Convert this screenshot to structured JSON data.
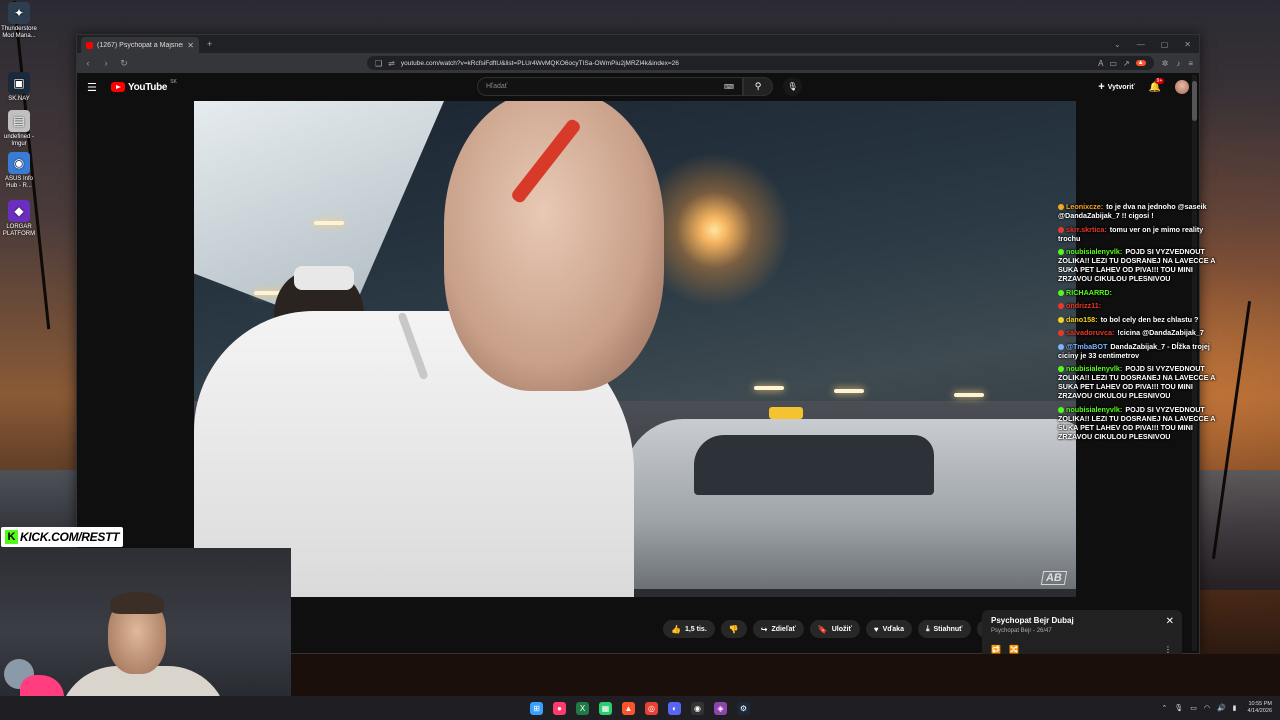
{
  "desktop": {
    "icons": [
      {
        "label": "Thunderstore Mod Mana...",
        "glyph": "✦",
        "color": "#2c3e50"
      },
      {
        "label": "SK.NAY",
        "glyph": "▣",
        "color": "#1b2a3a"
      },
      {
        "label": "undefined - Imgur",
        "glyph": "▤",
        "color": "#c0c0c0"
      },
      {
        "label": "ASUS Info Hub - R...",
        "glyph": "◉",
        "color": "#3a7bd5"
      },
      {
        "label": "LORGAR PLATFORM",
        "glyph": "◆",
        "color": "#6b2fbf"
      }
    ]
  },
  "browser": {
    "tab_title": "(1267) Psychopat a Majsner u",
    "url": "youtube.com/watch?v=kRcfsiFdftU&list=PLUr4WvMQKO6ocyTISa-OWmPiu2jMRZl4k&index=26"
  },
  "youtube": {
    "logo_text": "YouTube",
    "country_code": "SK",
    "search_placeholder": "Hľadať",
    "create_label": "Vytvoriť",
    "notif_count": "9+",
    "actions": {
      "likes": "1,5 tis.",
      "share": "Zdieľať",
      "save": "Uložiť",
      "thanks": "Vďaka",
      "download": "Stiahnuť"
    },
    "playlist": {
      "title": "Psychopat Bejr  Dubaj",
      "channel": "Psychopat Bejr",
      "position": "26/47"
    }
  },
  "chat": [
    {
      "user": "Leonixcze:",
      "text": "to je dva na jednoho @saseik @DandaZabijak_7 !! cigosi !",
      "color": "#f5a623"
    },
    {
      "user": "skrr.skrtica:",
      "text": "tomu ver on je mimo reality trochu",
      "color": "#e8392b"
    },
    {
      "user": "noubisialenyvlk:",
      "text": "POJD SI VYZVEDNOUT ZOLIKA!! LEZI TU DOSRANEJ NA LAVECCE A SUKA PET LAHEV OD PIVA!!! TOU MINI ZRZAVOU CIKULOU PLESNIVOU",
      "color": "#53fc18"
    },
    {
      "user": "RICHAARRD:",
      "text": "",
      "color": "#53fc18"
    },
    {
      "user": "ondrizz11:",
      "text": "",
      "color": "#e8392b"
    },
    {
      "user": "dano158:",
      "text": "to bol cely den bez chlastu ?",
      "color": "#f5d323"
    },
    {
      "user": "salvadoruvca:",
      "text": "!cicina @DandaZabijak_7",
      "color": "#e8392b"
    },
    {
      "user": "@TmbaBOT",
      "text": "DandaZabijak_7 - Dĺžka trojej ciciny je 33 centimetrov",
      "color": "#7ab4ff"
    },
    {
      "user": "noubisialenyvlk:",
      "text": "POJD SI VYZVEDNOUT ZOLIKA!! LEZI TU DOSRANEJ NA LAVECCE A SUKA PET LAHEV OD PIVA!!! TOU MINI ZRZAVOU CIKULOU PLESNIVOU",
      "color": "#53fc18"
    },
    {
      "user": "noubisialenyvlk:",
      "text": "POJD SI VYZVEDNOUT ZOLIKA!! LEZI TU DOSRANEJ NA LAVECCE A SUKA PET LAHEV OD PIVA!!! TOU MINI ZRZAVOU CIKULOU PLESNIVOU",
      "color": "#53fc18"
    }
  ],
  "overlay": {
    "kick_text": "KICK.COM/RESTT",
    "kick_logo": "K"
  },
  "taskbar": {
    "apps": [
      {
        "name": "windows-start-icon",
        "glyph": "⊞",
        "color": "#3aa0ff"
      },
      {
        "name": "maps-pin-icon",
        "glyph": "●",
        "color": "#ff3b6b"
      },
      {
        "name": "excel-icon",
        "glyph": "X",
        "color": "#1f7a45"
      },
      {
        "name": "spreadsheet-icon",
        "glyph": "▦",
        "color": "#2ecc71"
      },
      {
        "name": "brave-icon",
        "glyph": "▲",
        "color": "#fb542b"
      },
      {
        "name": "chrome-icon",
        "glyph": "◎",
        "color": "#e94235"
      },
      {
        "name": "discord-icon",
        "glyph": "◐",
        "color": "#5865f2"
      },
      {
        "name": "obs-icon",
        "glyph": "◉",
        "color": "#333"
      },
      {
        "name": "app-icon",
        "glyph": "◈",
        "color": "#8e44ad"
      },
      {
        "name": "steam-icon",
        "glyph": "⚙",
        "color": "#1b2838"
      }
    ],
    "time": "10:55 PM",
    "date": "4/14/2026"
  }
}
